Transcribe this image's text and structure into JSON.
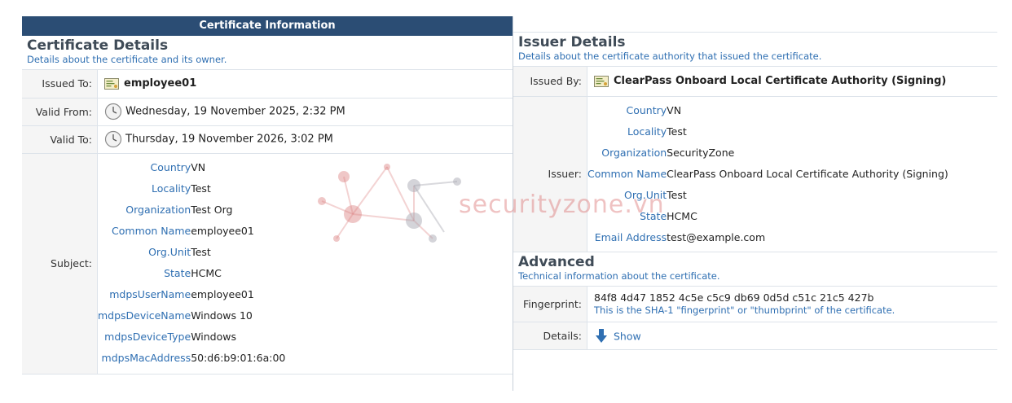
{
  "left": {
    "banner": "Certificate Information",
    "section": {
      "title": "Certificate Details",
      "subtitle": "Details about the certificate and its owner."
    },
    "issued_to": {
      "label": "Issued To:",
      "value": "employee01"
    },
    "valid_from": {
      "label": "Valid From:",
      "value": "Wednesday, 19 November 2025, 2:32 PM"
    },
    "valid_to": {
      "label": "Valid To:",
      "value": "Thursday, 19 November 2026, 3:02 PM"
    },
    "subject": {
      "label": "Subject:",
      "fields": [
        {
          "key": "Country",
          "value": "VN"
        },
        {
          "key": "Locality",
          "value": "Test"
        },
        {
          "key": "Organization",
          "value": "Test Org"
        },
        {
          "key": "Common Name",
          "value": "employee01"
        },
        {
          "key": "Org.Unit",
          "value": "Test"
        },
        {
          "key": "State",
          "value": "HCMC"
        },
        {
          "key": "mdpsUserName",
          "value": "employee01"
        },
        {
          "key": "mdpsDeviceName",
          "value": "Windows 10"
        },
        {
          "key": "mdpsDeviceType",
          "value": "Windows"
        },
        {
          "key": "mdpsMacAddress",
          "value": "50:d6:b9:01:6a:00"
        }
      ]
    }
  },
  "right": {
    "issuer_section": {
      "title": "Issuer Details",
      "subtitle": "Details about the certificate authority that issued the certificate."
    },
    "issued_by": {
      "label": "Issued By:",
      "value": "ClearPass Onboard Local Certificate Authority (Signing)"
    },
    "issuer": {
      "label": "Issuer:",
      "fields": [
        {
          "key": "Country",
          "value": "VN"
        },
        {
          "key": "Locality",
          "value": "Test"
        },
        {
          "key": "Organization",
          "value": "SecurityZone"
        },
        {
          "key": "Common Name",
          "value": "ClearPass Onboard Local Certificate Authority (Signing)"
        },
        {
          "key": "Org.Unit",
          "value": "Test"
        },
        {
          "key": "State",
          "value": "HCMC"
        },
        {
          "key": "Email Address",
          "value": "test@example.com"
        }
      ]
    },
    "advanced_section": {
      "title": "Advanced",
      "subtitle": "Technical information about the certificate."
    },
    "fingerprint": {
      "label": "Fingerprint:",
      "value": "84f8 4d47 1852 4c5e c5c9 db69 0d5d c51c 21c5 427b",
      "note": "This is the SHA-1 \"fingerprint\" or \"thumbprint\" of the certificate."
    },
    "details": {
      "label": "Details:",
      "link": "Show"
    }
  },
  "watermark": {
    "text": "securityzone.vn"
  },
  "icons": {
    "certificate": "certificate-icon",
    "clock": "clock-icon",
    "show": "arrow-down-icon"
  },
  "colors": {
    "banner_bg": "#2b4d74",
    "link_blue": "#2f6fb2",
    "label_bg": "#f5f5f5",
    "border": "#dde3ea"
  }
}
